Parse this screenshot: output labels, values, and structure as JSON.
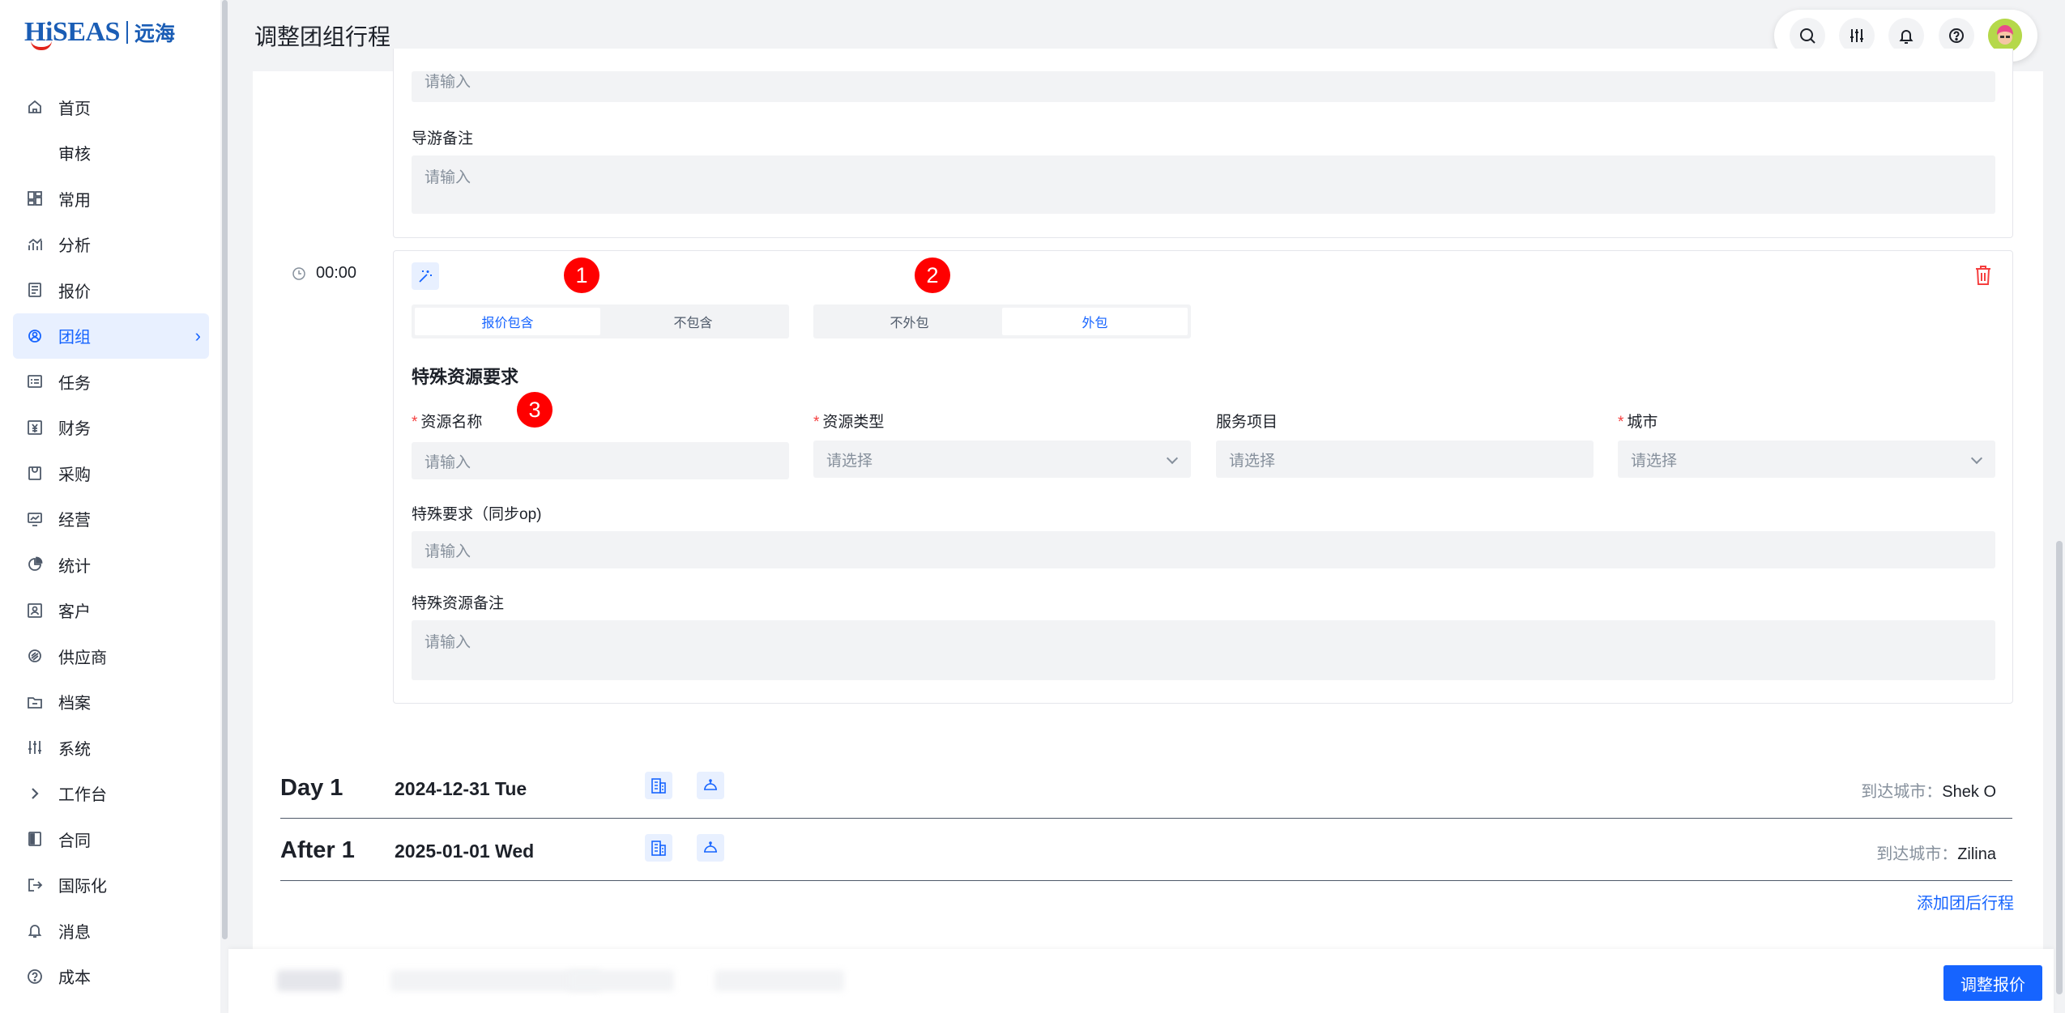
{
  "brand": {
    "logo_en": "HiSEAS",
    "logo_cn": "远海"
  },
  "page_title": "调整团组行程",
  "sidebar": {
    "items": [
      {
        "label": "首页",
        "icon": "home-icon"
      },
      {
        "label": "审核",
        "icon": ""
      },
      {
        "label": "常用",
        "icon": "grid-icon"
      },
      {
        "label": "分析",
        "icon": "chart-icon"
      },
      {
        "label": "报价",
        "icon": "document-icon"
      },
      {
        "label": "团组",
        "icon": "group-icon",
        "active": true
      },
      {
        "label": "任务",
        "icon": "task-icon"
      },
      {
        "label": "财务",
        "icon": "finance-icon"
      },
      {
        "label": "采购",
        "icon": "purchase-icon"
      },
      {
        "label": "经营",
        "icon": "monitor-icon"
      },
      {
        "label": "统计",
        "icon": "pie-chart-icon"
      },
      {
        "label": "客户",
        "icon": "customer-icon"
      },
      {
        "label": "供应商",
        "icon": "supplier-icon"
      },
      {
        "label": "档案",
        "icon": "folder-icon"
      },
      {
        "label": "系统",
        "icon": "settings-sliders-icon"
      },
      {
        "label": "工作台",
        "icon": "chevron-right-icon"
      },
      {
        "label": "合同",
        "icon": "contract-icon"
      },
      {
        "label": "国际化",
        "icon": "logout-icon"
      },
      {
        "label": "消息",
        "icon": "bell-icon"
      },
      {
        "label": "成本",
        "icon": "help-circle-icon"
      }
    ]
  },
  "toolbar": {
    "icons": [
      "search-icon",
      "sliders-icon",
      "bell-icon",
      "help-icon",
      "avatar"
    ]
  },
  "upper_card": {
    "top_input_placeholder": "请输入",
    "guide_note_label": "导游备注",
    "guide_note_placeholder": "请输入"
  },
  "item": {
    "time": "00:00",
    "badges": [
      "1",
      "2",
      "3"
    ],
    "quote_toggle": {
      "options": [
        "报价包含",
        "不包含"
      ],
      "selected": "报价包含"
    },
    "outsource_toggle": {
      "options": [
        "不外包",
        "外包"
      ],
      "selected": "外包"
    },
    "section_title": "特殊资源要求",
    "fields": {
      "resource_name": {
        "label": "资源名称",
        "required": true,
        "placeholder": "请输入"
      },
      "resource_type": {
        "label": "资源类型",
        "required": true,
        "placeholder": "请选择"
      },
      "service_item": {
        "label": "服务项目",
        "required": false,
        "placeholder": "请选择"
      },
      "city": {
        "label": "城市",
        "required": true,
        "placeholder": "请选择"
      },
      "special_req": {
        "label": "特殊要求（同步op)",
        "placeholder": "请输入"
      },
      "special_note": {
        "label": "特殊资源备注",
        "placeholder": "请输入"
      }
    }
  },
  "days": [
    {
      "label": "Day 1",
      "date": "2024-12-31 Tue",
      "city_label": "到达城市：",
      "city": "Shek O"
    },
    {
      "label": "After 1",
      "date": "2025-01-01 Wed",
      "city_label": "到达城市：",
      "city": "Zilina"
    }
  ],
  "add_after_link": "添加团后行程",
  "footer": {
    "primary_button": "调整报价"
  },
  "colors": {
    "primary": "#1664ff",
    "danger": "#f53f3f",
    "badge": "#ff0000"
  }
}
